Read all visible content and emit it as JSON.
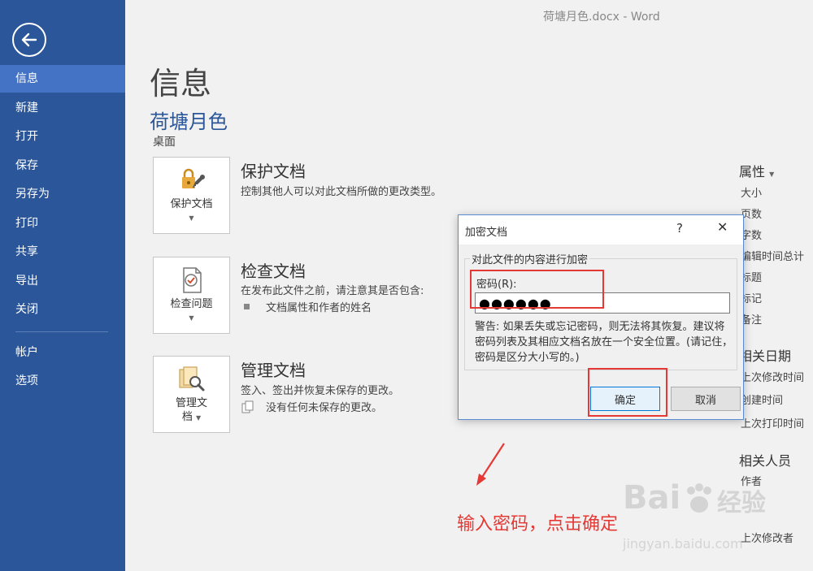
{
  "window": {
    "title": "荷塘月色.docx - Word"
  },
  "sidebar": {
    "items": [
      {
        "label": "信息"
      },
      {
        "label": "新建"
      },
      {
        "label": "打开"
      },
      {
        "label": "保存"
      },
      {
        "label": "另存为"
      },
      {
        "label": "打印"
      },
      {
        "label": "共享"
      },
      {
        "label": "导出"
      },
      {
        "label": "关闭"
      },
      {
        "label": "帐户"
      },
      {
        "label": "选项"
      }
    ]
  },
  "main": {
    "page_title": "信息",
    "doc_name": "荷塘月色",
    "doc_location": "桌面",
    "sections": [
      {
        "tile_label": "保护文档",
        "heading": "保护文档",
        "description": "控制其他人可以对此文档所做的更改类型。"
      },
      {
        "tile_label": "检查问题",
        "heading": "检查文档",
        "description": "在发布此文件之前，请注意其是否包含:",
        "bullet": "文档属性和作者的姓名"
      },
      {
        "tile_label_line1": "管理文",
        "tile_label_line2": "档",
        "heading": "管理文档",
        "description": "签入、签出并恢复未保存的更改。",
        "bullet": "没有任何未保存的更改。"
      }
    ]
  },
  "properties": {
    "heading": "属性",
    "items": [
      "大小",
      "页数",
      "字数",
      "编辑时间总计",
      "标题",
      "标记",
      "备注"
    ],
    "dates_heading": "相关日期",
    "dates": [
      "上次修改时间",
      "创建时间",
      "上次打印时间"
    ],
    "people_heading": "相关人员",
    "people": [
      "作者"
    ],
    "last_modified_by": "上次修改者"
  },
  "dialog": {
    "title": "加密文档",
    "help": "?",
    "close": "✕",
    "group_label": "对此文件的内容进行加密",
    "password_label": "密码(R):",
    "password_value": "●●●●●●",
    "warning": "警告: 如果丢失或忘记密码，则无法将其恢复。建议将密码列表及其相应文档名放在一个安全位置。(请记住，密码是区分大小写的。)",
    "ok_label": "确定",
    "cancel_label": "取消"
  },
  "annotation": {
    "text": "输入密码，点击确定",
    "color": "#e53935"
  },
  "watermark": {
    "brand": "Bai",
    "brand_suffix": "经验",
    "url": "jingyan.baidu.com"
  },
  "colors": {
    "accent": "#2b579a",
    "sidebar_active": "#4472c4"
  }
}
